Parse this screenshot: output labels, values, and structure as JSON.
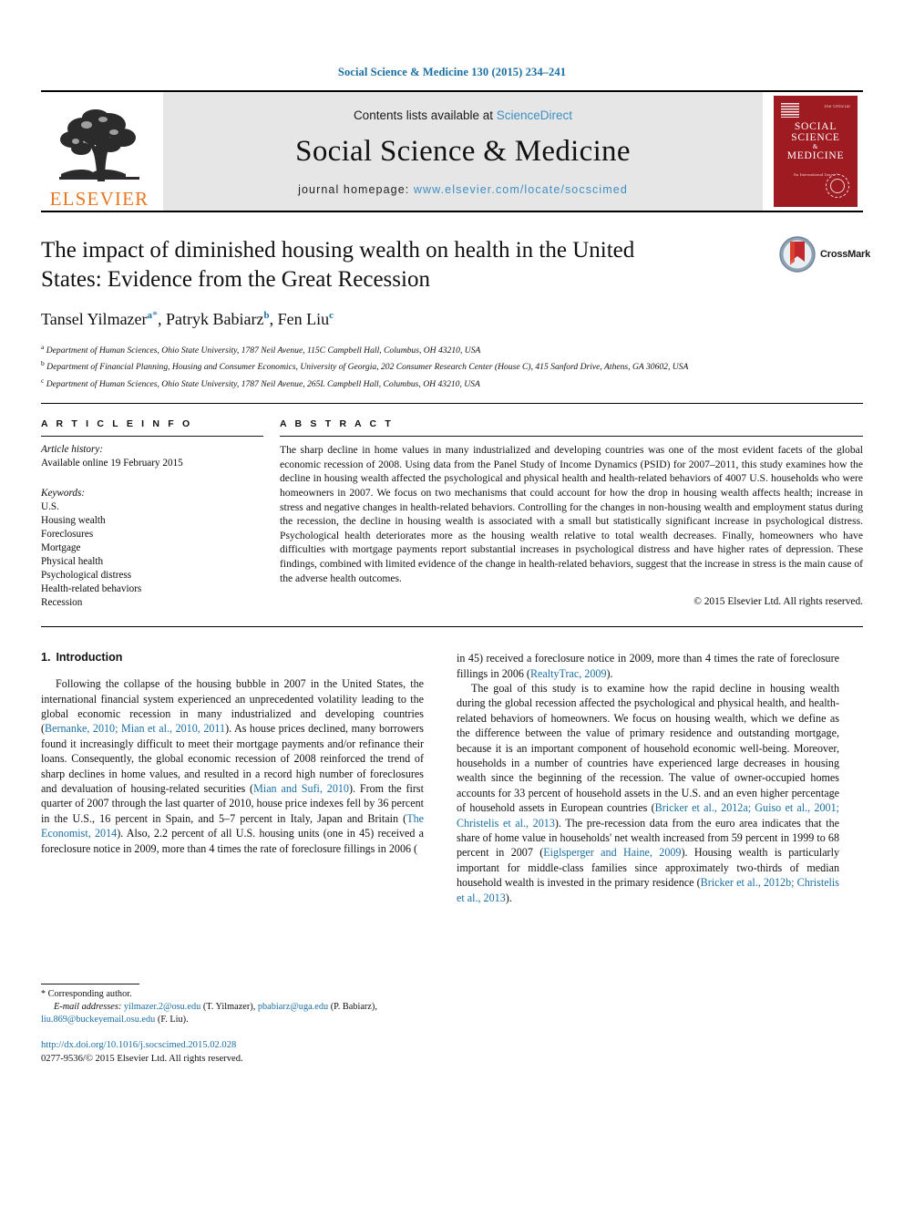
{
  "running_head": "Social Science & Medicine 130 (2015) 234–241",
  "masthead": {
    "publisher_wordmark": "ELSEVIER",
    "contents_prefix": "Contents lists available at ",
    "contents_link": "ScienceDirect",
    "journal_name": "Social Science & Medicine",
    "homepage_prefix": "journal homepage: ",
    "homepage_url": "www.elsevier.com/locate/socscimed",
    "cover": {
      "line1": "SOCIAL",
      "line2": "SCIENCE",
      "amp": "&",
      "line3": "MEDICINE",
      "subtitle": "An International Journal",
      "corner_note": "The Official"
    }
  },
  "crossmark": {
    "label": "CrossMark"
  },
  "article": {
    "title": "The impact of diminished housing wealth on health in the United States: Evidence from the Great Recession",
    "authors": [
      {
        "name": "Tansel Yilmazer",
        "sup": "a",
        "star": "*"
      },
      {
        "name": "Patryk Babiarz",
        "sup": "b",
        "star": ""
      },
      {
        "name": "Fen Liu",
        "sup": "c",
        "star": ""
      }
    ],
    "affiliations": [
      {
        "marker": "a",
        "text": "Department of Human Sciences, Ohio State University, 1787 Neil Avenue, 115C Campbell Hall, Columbus, OH 43210, USA"
      },
      {
        "marker": "b",
        "text": "Department of Financial Planning, Housing and Consumer Economics, University of Georgia, 202 Consumer Research Center (House C), 415 Sanford Drive, Athens, GA 30602, USA"
      },
      {
        "marker": "c",
        "text": "Department of Human Sciences, Ohio State University, 1787 Neil Avenue, 265L Campbell Hall, Columbus, OH 43210, USA"
      }
    ]
  },
  "article_info": {
    "heading": "A R T I C L E   I N F O",
    "history_label": "Article history:",
    "history_value": "Available online 19 February 2015",
    "keywords_label": "Keywords:",
    "keywords": [
      "U.S.",
      "Housing wealth",
      "Foreclosures",
      "Mortgage",
      "Physical health",
      "Psychological distress",
      "Health-related behaviors",
      "Recession"
    ]
  },
  "abstract": {
    "heading": "A B S T R A C T",
    "text": "The sharp decline in home values in many industrialized and developing countries was one of the most evident facets of the global economic recession of 2008. Using data from the Panel Study of Income Dynamics (PSID) for 2007–2011, this study examines how the decline in housing wealth affected the psychological and physical health and health-related behaviors of 4007 U.S. households who were homeowners in 2007. We focus on two mechanisms that could account for how the drop in housing wealth affects health; increase in stress and negative changes in health-related behaviors. Controlling for the changes in non-housing wealth and employment status during the recession, the decline in housing wealth is associated with a small but statistically significant increase in psychological distress. Psychological health deteriorates more as the housing wealth relative to total wealth decreases. Finally, homeowners who have difficulties with mortgage payments report substantial increases in psychological distress and have higher rates of depression. These findings, combined with limited evidence of the change in health-related behaviors, suggest that the increase in stress is the main cause of the adverse health outcomes.",
    "copyright": "© 2015 Elsevier Ltd. All rights reserved."
  },
  "introduction": {
    "number": "1.",
    "title": "Introduction",
    "left_paragraph_1_a": "Following the collapse of the housing bubble in 2007 in the United States, the international financial system experienced an unprecedented volatility leading to the global economic recession in many industrialized and developing countries (",
    "cite_1": "Bernanke, 2010; Mian et al., 2010, 2011",
    "left_paragraph_1_b": "). As house prices declined, many borrowers found it increasingly difficult to meet their mortgage payments and/or refinance their loans. Consequently, the global economic recession of 2008 reinforced the trend of sharp declines in home values, and resulted in a record high number of foreclosures and devaluation of housing-related securities (",
    "cite_2": "Mian and Sufi, 2010",
    "left_paragraph_1_c": "). From the first quarter of 2007 through the last quarter of 2010, house price indexes fell by 36 percent in the U.S., 16 percent in Spain, and 5–7 percent in Italy, Japan and Britain (",
    "cite_3": "The Economist, 2014",
    "left_paragraph_1_d": "). Also, 2.2 percent of all U.S. housing units (one in 45) received a foreclosure notice in 2009, more than 4 times the rate of foreclosure fillings in 2006 (",
    "cite_4": "RealtyTrac, 2009",
    "left_paragraph_1_e": ").",
    "right_paragraph_2_a": "The goal of this study is to examine how the rapid decline in housing wealth during the global recession affected the psychological and physical health, and health-related behaviors of homeowners. We focus on housing wealth, which we define as the difference between the value of primary residence and outstanding mortgage, because it is an important component of household economic well-being. Moreover, households in a number of countries have experienced large decreases in housing wealth since the beginning of the recession. The value of owner-occupied homes accounts for 33 percent of household assets in the U.S. and an even higher percentage of household assets in European countries (",
    "cite_5": "Bricker et al., 2012a; Guiso et al., 2001; Christelis et al., 2013",
    "right_paragraph_2_b": "). The pre-recession data from the euro area indicates that the share of home value in households' net wealth increased from 59 percent in 1999 to 68 percent in 2007 (",
    "cite_6": "Eiglsperger and Haine, 2009",
    "right_paragraph_2_c": "). Housing wealth is particularly important for middle-class families since approximately two-thirds of median household wealth is invested in the primary residence (",
    "cite_7": "Bricker et al., 2012b; Christelis et al., 2013",
    "right_paragraph_2_d": ")."
  },
  "footnote": {
    "star": "*",
    "corresponding": " Corresponding author.",
    "email_label": "E-mail addresses:",
    "emails": [
      {
        "address": "yilmazer.2@osu.edu",
        "person": "(T. Yilmazer)"
      },
      {
        "address": "pbabiarz@uga.edu",
        "person": "(P. Babiarz)"
      },
      {
        "address": "liu.869@buckeyemail.osu.edu",
        "person": "(F. Liu)"
      }
    ],
    "doi": "http://dx.doi.org/10.1016/j.socscimed.2015.02.028",
    "issn_line": "0277-9536/© 2015 Elsevier Ltd. All rights reserved."
  },
  "colors": {
    "link": "#1a6fa3",
    "elsevier_orange": "#E87722",
    "cover_red": "#9e1b22",
    "band_gray": "#e6e6e6"
  }
}
